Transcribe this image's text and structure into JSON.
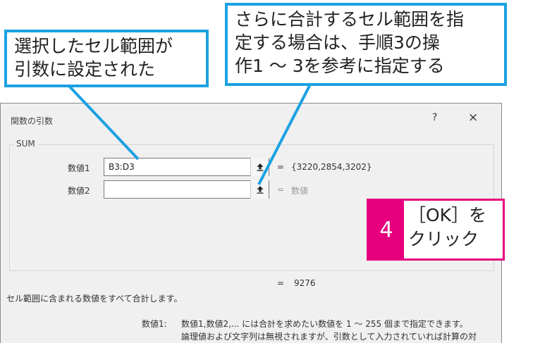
{
  "dialog": {
    "title": "関数の引数",
    "help": "?",
    "close": "×",
    "function_name": "SUM",
    "args": [
      {
        "label": "数値1",
        "value": "B3:D3",
        "result": "{3220,2854,3202}"
      },
      {
        "label": "数値2",
        "value": "",
        "result": "数値"
      }
    ],
    "equals": "=",
    "total_equals": "=",
    "total": "9276",
    "description": "セル範囲に含まれる数値をすべて合計します。",
    "arg_help_label": "数値1:",
    "arg_help_line1": "数値1,数値2,... には合計を求めたい数値を 1 ～ 255 個まで指定できます。",
    "arg_help_line2": "論理値および文字列は無視されますが、引数として入力されていれば計算の対"
  },
  "callouts": {
    "left_line1": "選択したセル範囲が",
    "left_line2": "引数に設定された",
    "right_line1": "さらに合計するセル範囲を指",
    "right_line2": "定する場合は、手順3の操",
    "right_line3": "作1 ～ 3を参考に指定する",
    "step_number": "4",
    "step_line1": "［OK］を",
    "step_line2": "クリック"
  },
  "colors": {
    "callout_border": "#1ba1e2",
    "step_accent": "#e6007e"
  },
  "icons": {
    "collapse_button": "upload-arrow-icon"
  }
}
